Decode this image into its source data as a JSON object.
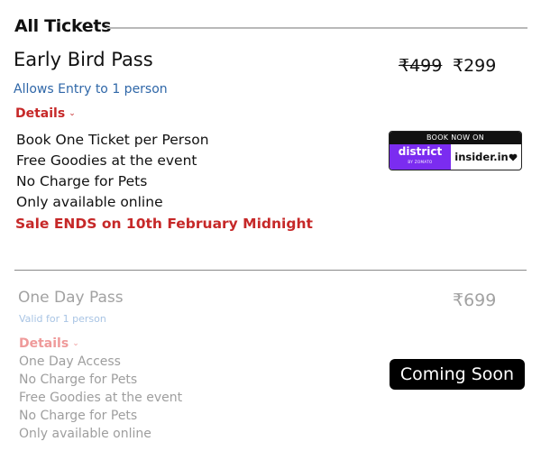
{
  "section": {
    "title": "All Tickets"
  },
  "early_bird": {
    "name": "Early Bird Pass",
    "old_price": "₹499",
    "price": "₹299",
    "subtitle": "Allows Entry to 1 person",
    "details_label": "Details",
    "features": [
      "Book One Ticket per Person",
      "Free Goodies at the event",
      "No Charge for Pets",
      "Only available online"
    ],
    "sale_note": "Sale ENDS on 10th February Midnight",
    "badge": {
      "top_label": "BOOK NOW ON",
      "district_label": "district",
      "district_sub": "BY ZOMATO",
      "insider_label": "insider.in"
    }
  },
  "one_day": {
    "name": "One Day Pass",
    "price": "₹699",
    "subtitle": "Valid for 1 person",
    "details_label": "Details",
    "features": [
      "One Day Access",
      "No Charge for Pets",
      "Free Goodies at the event",
      "No Charge for Pets",
      "Only available online"
    ],
    "status_button": "Coming Soon"
  },
  "colors": {
    "accent_red": "#c62828",
    "link_blue": "#2f67a8",
    "district_purple": "#7b2cf0"
  },
  "icons": {
    "details_chevron": "chevron-down-icon",
    "insider_heart": "heart-icon"
  }
}
